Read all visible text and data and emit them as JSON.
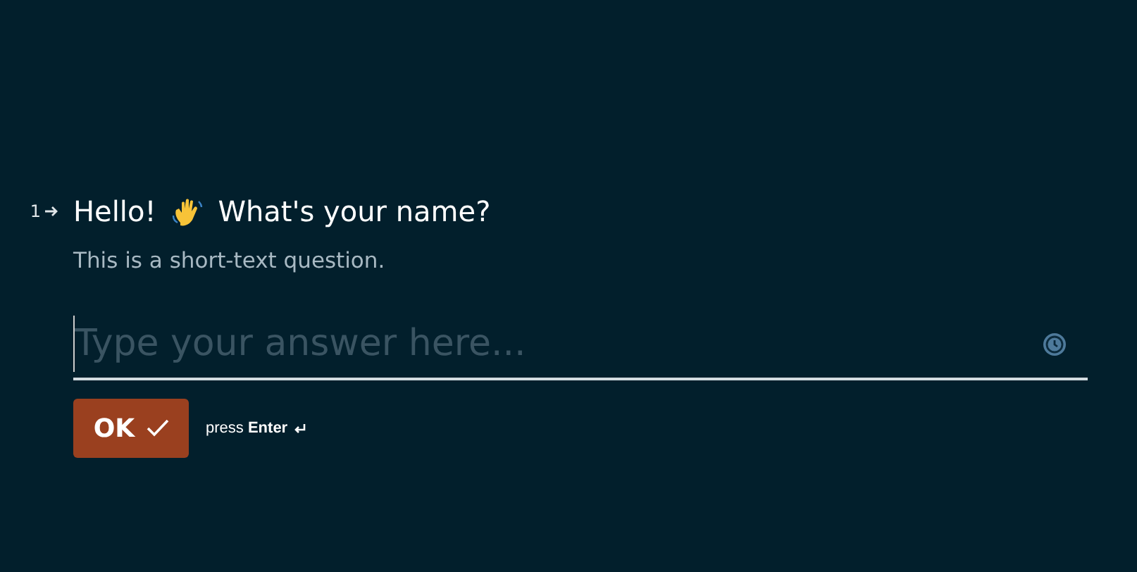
{
  "question": {
    "number": "1",
    "title_start": "Hello!",
    "title_end": "What's your name?",
    "description": "This is a short-text question."
  },
  "answer": {
    "placeholder": "Type your answer here..."
  },
  "ok_button": {
    "label": "OK"
  },
  "hint": "press **Enter**"
}
